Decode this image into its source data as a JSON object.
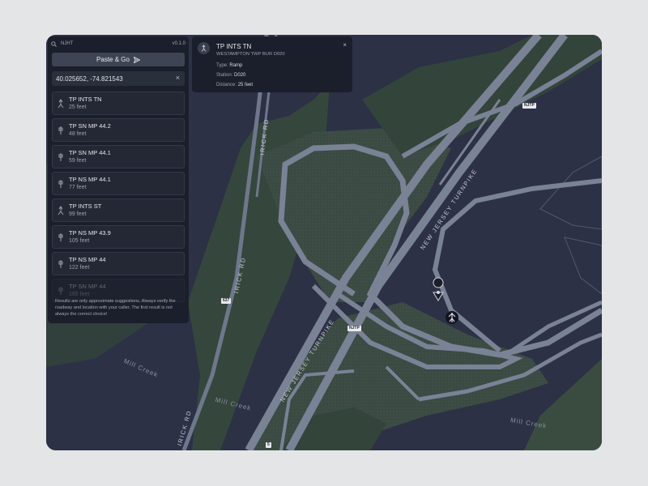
{
  "app": {
    "name": "NJHT",
    "version": "v0.1.0"
  },
  "toolbar": {
    "paste_label": "Paste & Go"
  },
  "search": {
    "value": "40.025652, -74.821543",
    "clear_icon": "close-icon"
  },
  "results": [
    {
      "name": "TP INTS TN",
      "distance": "25 feet",
      "icon": "ramp-icon"
    },
    {
      "name": "TP SN MP 44.2",
      "distance": "48 feet",
      "icon": "milepost-icon"
    },
    {
      "name": "TP SN MP 44.1",
      "distance": "59 feet",
      "icon": "milepost-icon"
    },
    {
      "name": "TP NS MP 44.1",
      "distance": "77 feet",
      "icon": "milepost-icon"
    },
    {
      "name": "TP INTS ST",
      "distance": "99 feet",
      "icon": "ramp-icon"
    },
    {
      "name": "TP NS MP 43.9",
      "distance": "105 feet",
      "icon": "milepost-icon"
    },
    {
      "name": "TP NS MP 44",
      "distance": "122 feet",
      "icon": "milepost-icon"
    },
    {
      "name": "TP SN MP 44",
      "distance": "165 feet",
      "icon": "milepost-icon"
    }
  ],
  "disclaimer": "Results are only approximate suggestions. Always verify the roadway and location with your caller. The first result is not always the correct choice!",
  "popup": {
    "title": "TP INTS TN",
    "subtitle": "WESTAMPTON TWP BUR D020",
    "type_label": "Type:",
    "type_value": "Ramp",
    "station_label": "Station:",
    "station_value": "D020",
    "distance_label": "Distance:",
    "distance_value": "25 feet",
    "close": "×"
  },
  "map": {
    "labels": {
      "irick_rd_1": "IRICK RD",
      "irick_rd_2": "IRICK RD",
      "irick_rd_3": "IRICK RD",
      "turnpike_1": "NEW JERSEY TURNPIKE",
      "turnpike_2": "NEW JERSEY TURNPIKE",
      "creek_1": "Mill Creek",
      "creek_2": "Mill Creek",
      "creek_3": "Mill Creek"
    },
    "shields": {
      "s1": "NJTP",
      "s2": "NJTP",
      "s3": "637",
      "s4": "5"
    }
  },
  "colors": {
    "map_background": "#2c3146",
    "land_green": "#39493f",
    "road": "#767e93",
    "panel": "#1b1f2b",
    "button": "#3f4454"
  }
}
